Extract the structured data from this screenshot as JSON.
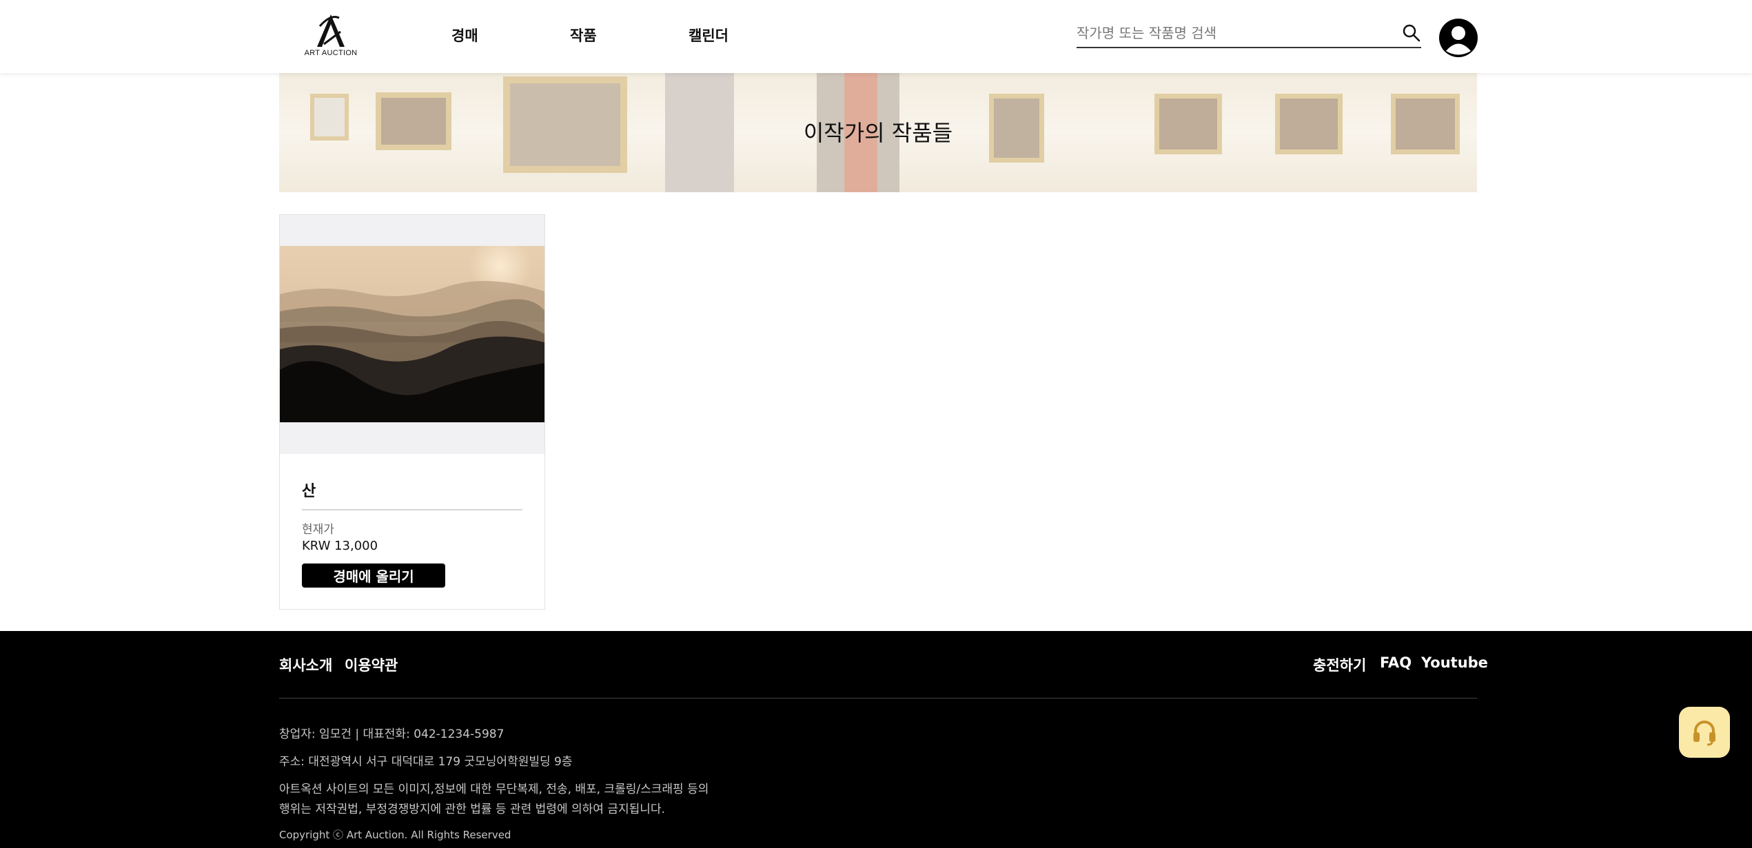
{
  "header": {
    "logo_text": "ART AUCTION",
    "nav": [
      {
        "label": "경매"
      },
      {
        "label": "작품"
      },
      {
        "label": "캘린더"
      }
    ],
    "search_placeholder": "작가명 또는 작품명 검색"
  },
  "banner": {
    "title": "이작가의 작품들"
  },
  "artwork": {
    "title": "산",
    "price_label": "현재가",
    "price_value": "KRW 13,000",
    "action_label": "경매에 올리기"
  },
  "footer": {
    "links_left": [
      "회사소개",
      "이용약관"
    ],
    "links_right": [
      "충전하기",
      "FAQ",
      "Youtube"
    ],
    "founder_line": "창업자: 임모건 | 대표전화: 042-1234-5987",
    "address_line": "주소: 대전광역시 서구 대덕대로 179 굿모닝어학원빌딩 9층",
    "notice_line1": "아트옥션 사이트의 모든 이미지,정보에 대한 무단복제, 전송, 배포, 크롤링/스크래핑 등의",
    "notice_line2": "행위는 저작권법, 부정경쟁방지에 관한 법률 등 관련 법령에 의하여 금지됩니다.",
    "copyright": "Copyright ⓒ Art Auction. All Rights Reserved"
  },
  "colors": {
    "footer_bg": "#000000",
    "support_button": "#fbe9a8",
    "support_icon": "#c8922a"
  },
  "icons": [
    "logo-icon",
    "search-icon",
    "user-avatar-icon",
    "headset-icon"
  ]
}
